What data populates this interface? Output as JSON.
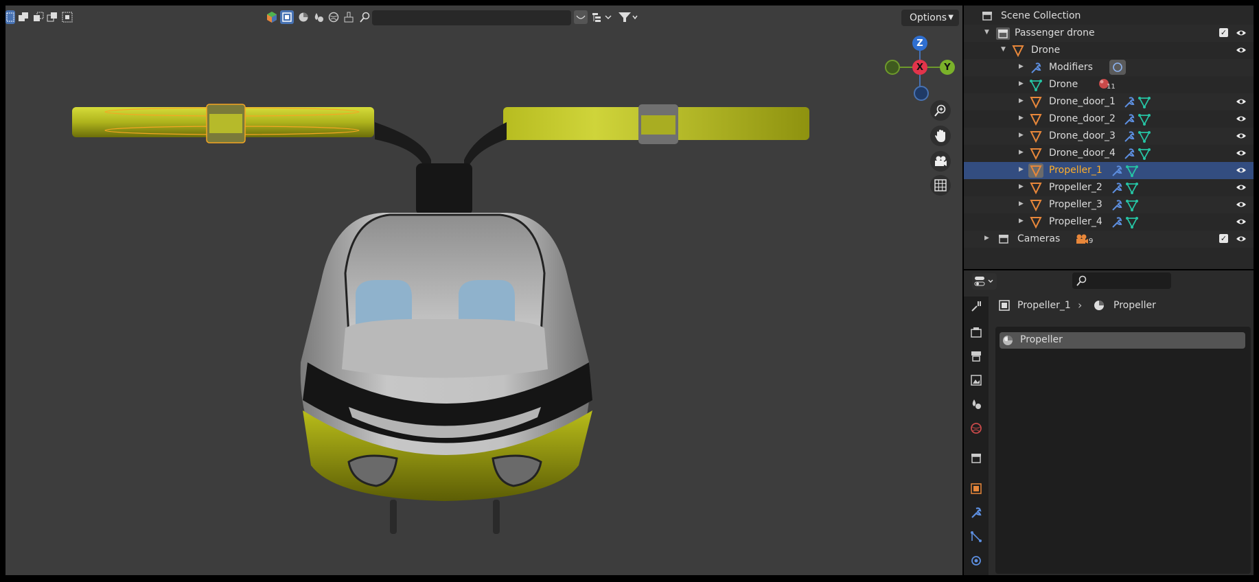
{
  "viewport": {
    "options_label": "Options",
    "gizmo": {
      "z": "Z",
      "x": "X",
      "y": "Y"
    },
    "search_placeholder": ""
  },
  "outliner": {
    "root": "Scene Collection",
    "rows": [
      {
        "label": "Passenger drone",
        "kind": "collection"
      },
      {
        "label": "Drone",
        "kind": "object"
      },
      {
        "label": "Modifiers",
        "kind": "modifiers"
      },
      {
        "label": "Drone",
        "kind": "mesh",
        "badge": "11"
      },
      {
        "label": "Drone_door_1",
        "kind": "object"
      },
      {
        "label": "Drone_door_2",
        "kind": "object"
      },
      {
        "label": "Drone_door_3",
        "kind": "object"
      },
      {
        "label": "Drone_door_4",
        "kind": "object"
      },
      {
        "label": "Propeller_1",
        "kind": "object",
        "selected": true
      },
      {
        "label": "Propeller_2",
        "kind": "object"
      },
      {
        "label": "Propeller_3",
        "kind": "object"
      },
      {
        "label": "Propeller_4",
        "kind": "object"
      },
      {
        "label": "Cameras",
        "kind": "collection",
        "badge": "9"
      }
    ]
  },
  "properties": {
    "breadcrumb_object": "Propeller_1",
    "breadcrumb_material": "Propeller",
    "material_slot": "Propeller"
  },
  "colors": {
    "accent": "#4772b3",
    "selected_row": "#334d80",
    "active_text": "#ffaf29",
    "object_icon": "#e8873a",
    "mesh_icon": "#26c4a4"
  }
}
